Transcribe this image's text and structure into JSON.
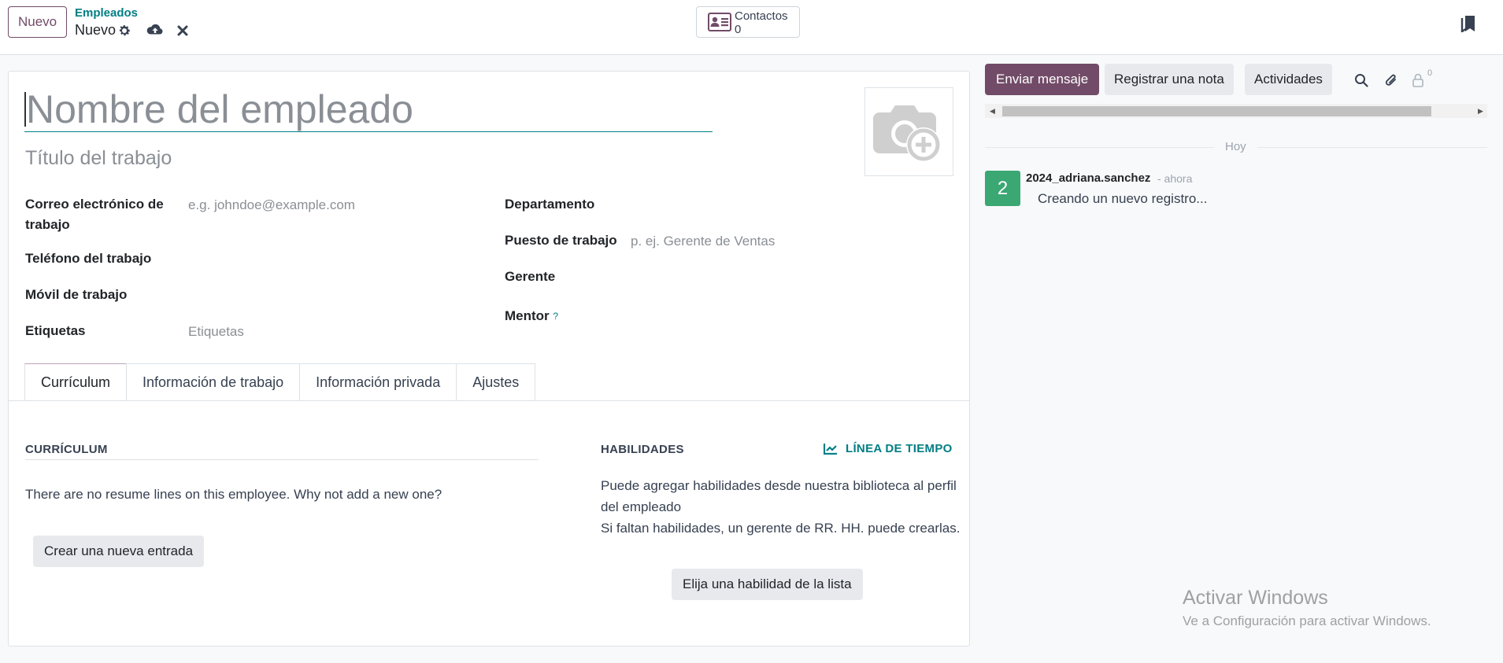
{
  "header": {
    "new_button": "Nuevo",
    "breadcrumb": "Empleados",
    "record_title": "Nuevo",
    "contacts_label": "Contactos",
    "contacts_count": "0"
  },
  "form": {
    "name_placeholder": "Nombre del empleado",
    "job_title_placeholder": "Título del trabajo",
    "left_fields": {
      "work_email_label": "Correo electrónico de trabajo",
      "work_email_placeholder": "e.g. johndoe@example.com",
      "work_phone_label": "Teléfono del trabajo",
      "mobile_label": "Móvil de trabajo",
      "tags_label": "Etiquetas",
      "tags_placeholder": "Etiquetas"
    },
    "right_fields": {
      "department_label": "Departamento",
      "job_position_label": "Puesto de trabajo",
      "job_position_placeholder": "p. ej. Gerente de Ventas",
      "manager_label": "Gerente",
      "mentor_label": "Mentor",
      "mentor_help": "?"
    },
    "tabs": [
      {
        "label": "Currículum",
        "active": true
      },
      {
        "label": "Información de trabajo",
        "active": false
      },
      {
        "label": "Información privada",
        "active": false
      },
      {
        "label": "Ajustes",
        "active": false
      }
    ],
    "resume": {
      "title": "CURRÍCULUM",
      "empty_text": "There are no resume lines on this employee. Why not add a new one?",
      "create_button": "Crear una nueva entrada"
    },
    "skills": {
      "title": "HABILIDADES",
      "timeline_link": "LÍNEA DE TIEMPO",
      "text_line1": "Puede agregar habilidades desde nuestra biblioteca al perfil del empleado",
      "text_line2": "Si faltan habilidades, un gerente de RR. HH. puede crearlas.",
      "pick_button": "Elija una habilidad de la lista"
    }
  },
  "chatter": {
    "send_message": "Enviar mensaje",
    "log_note": "Registrar una nota",
    "activities": "Actividades",
    "follower_count": "0",
    "day_label": "Hoy",
    "message": {
      "avatar_text": "2",
      "author": "2024_adriana.sanchez",
      "time": "- ahora",
      "body": "Creando un nuevo registro..."
    }
  },
  "watermark": {
    "title": "Activar Windows",
    "subtitle": "Ve a Configuración para activar Windows."
  },
  "colors": {
    "brand": "#714b67",
    "accent": "#017e84",
    "avatar_green": "#3ba773"
  },
  "icons": [
    "gear-icon",
    "cloud-upload-icon",
    "close-icon",
    "contact-card-icon",
    "bookmark-icon",
    "camera-plus-icon",
    "chart-line-icon",
    "search-icon",
    "paperclip-icon",
    "user-lock-icon"
  ]
}
